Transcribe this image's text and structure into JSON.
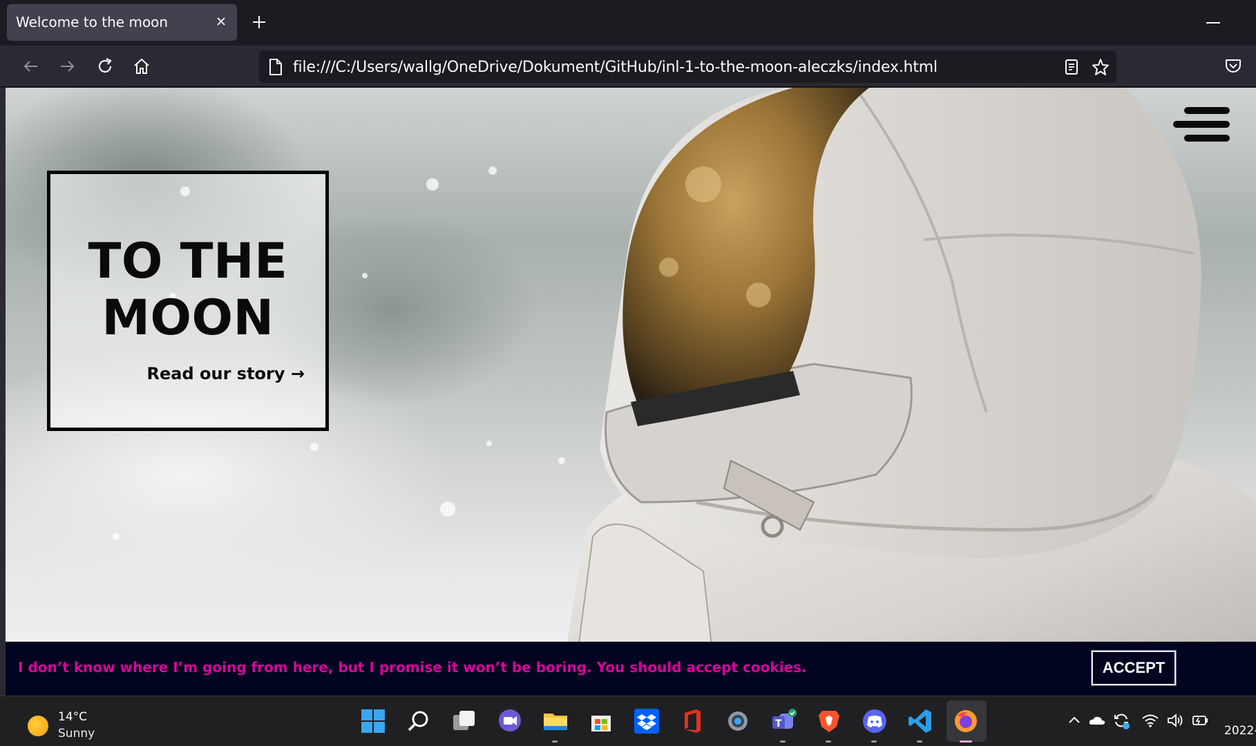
{
  "browser": {
    "tab_title": "Welcome to the moon",
    "url": "file:///C:/Users/wallg/OneDrive/Dokument/GitHub/inl-1-to-the-moon-aleczks/index.html"
  },
  "page": {
    "hero_title_line1": "TO THE",
    "hero_title_line2": "MOON",
    "hero_link": "Read our story →",
    "cookie_text": "I don’t know where I’m going from here, but I promise it won’t be boring. You should accept cookies.",
    "accept_label": "ACCEPT"
  },
  "taskbar": {
    "weather_temp": "14°C",
    "weather_condition": "Sunny",
    "clock": "2022-",
    "pinned_apps": [
      "windows-start",
      "search",
      "task-view",
      "meet",
      "file-explorer",
      "microsoft-store",
      "dropbox",
      "office",
      "settings",
      "teams",
      "brave",
      "discord",
      "vscode",
      "firefox"
    ]
  },
  "colors": {
    "cookie_text": "#d5069a",
    "cookie_bg": "#02051f",
    "browser_toolbar": "#2b2a33",
    "taskbar": "#202023"
  }
}
